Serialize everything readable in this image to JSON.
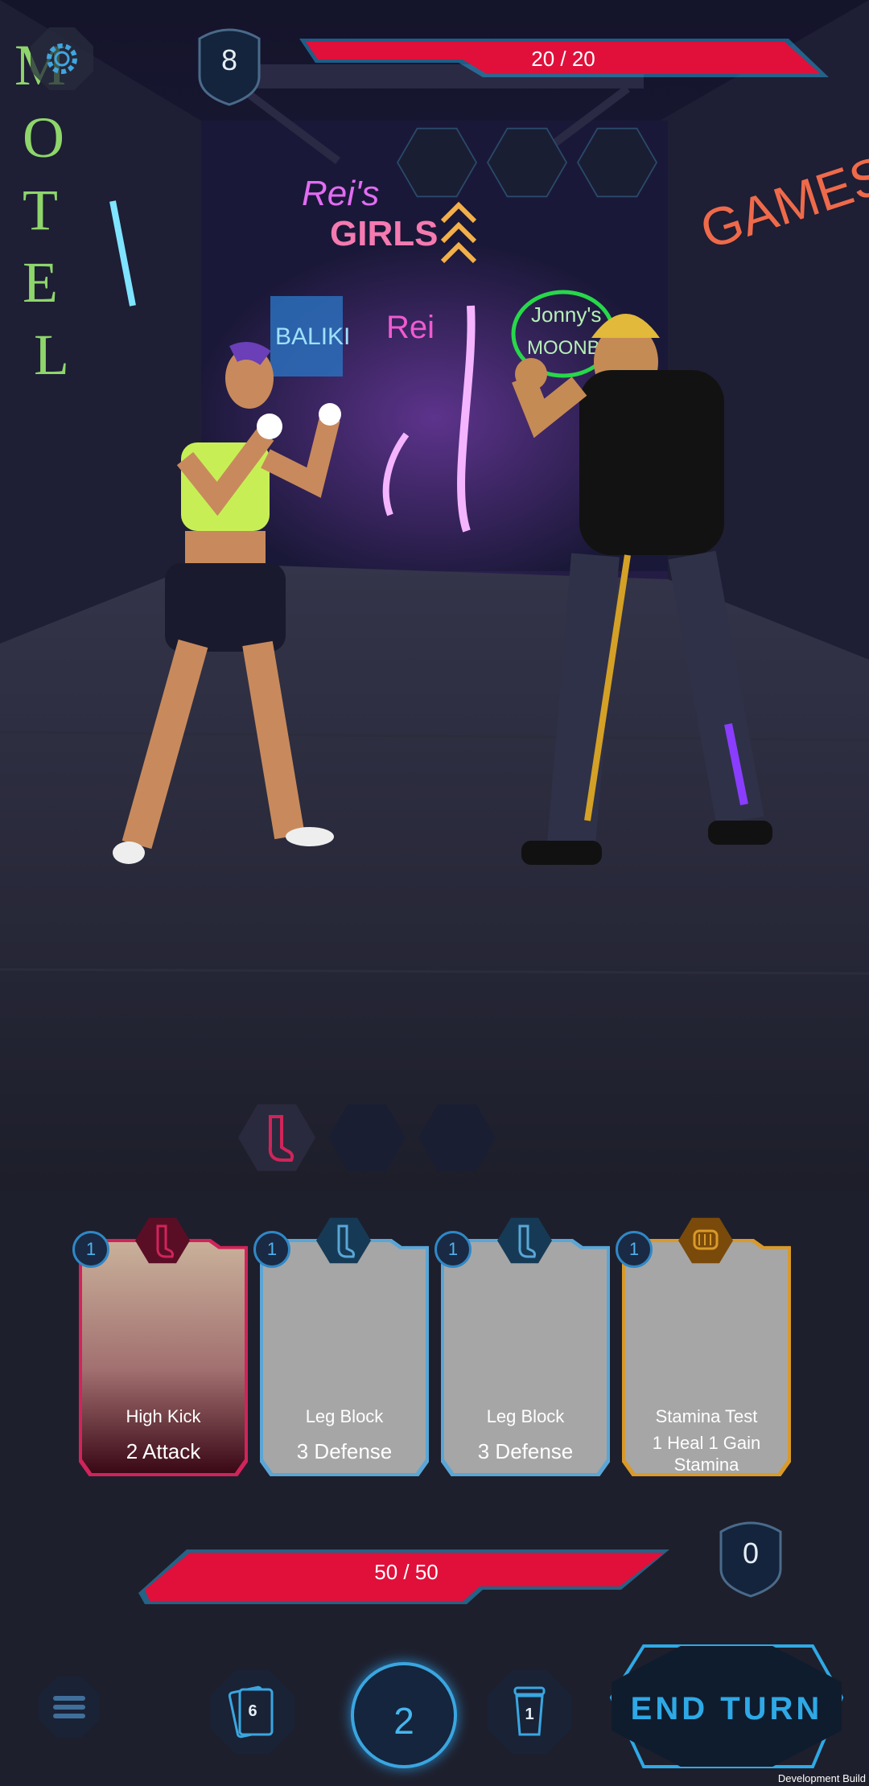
{
  "enemy": {
    "block": "8",
    "hp_current": "20",
    "hp_max": "20",
    "hp_text": "20  / 20",
    "intent_slots": 3
  },
  "player": {
    "hp_text": "50  / 50",
    "block": "0",
    "stance_slots": [
      "leg-icon",
      "",
      ""
    ]
  },
  "signs": {
    "motel": "MOTEL",
    "reis": "Rei's",
    "girls": "GIRLS",
    "baliki": "BALIKI",
    "jonnys": "Jonny's",
    "moonbe": "MOONBE",
    "games": "GAMES"
  },
  "hand": [
    {
      "cost": "1",
      "type_icon": "leg-icon",
      "title": "High Kick",
      "desc": "2 Attack",
      "color": "#d0245a",
      "art": true
    },
    {
      "cost": "1",
      "type_icon": "leg-icon",
      "title": "Leg Block",
      "desc": "3 Defense",
      "color": "#5aa6d6",
      "art": false
    },
    {
      "cost": "1",
      "type_icon": "leg-icon",
      "title": "Leg Block",
      "desc": "3 Defense",
      "color": "#5aa6d6",
      "art": false
    },
    {
      "cost": "1",
      "type_icon": "fist-icon",
      "title": "Stamina Test",
      "desc": "1 Heal 1 Gain Stamina",
      "color": "#d99a2a",
      "art": false
    }
  ],
  "bottom": {
    "draw_pile": "6",
    "energy": "2",
    "discard_pile": "1",
    "end_turn": "END TURN",
    "dev_build": "Development Build"
  },
  "colors": {
    "hp_red": "#e0103a",
    "accent_blue": "#2ea9e6"
  }
}
